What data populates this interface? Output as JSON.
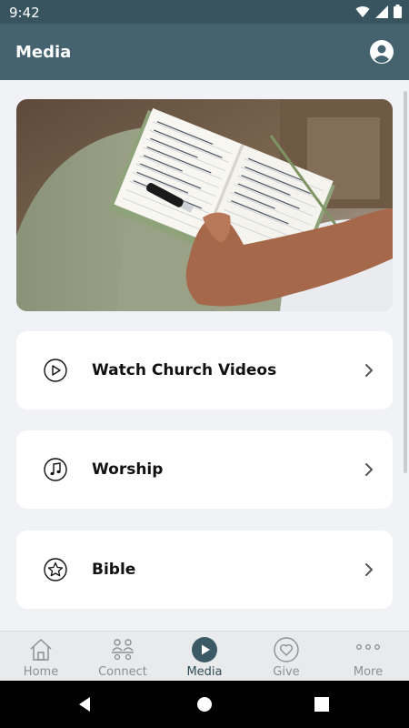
{
  "status_bar": {
    "time": "9:42"
  },
  "app_bar": {
    "title": "Media"
  },
  "cards": [
    {
      "label": "Watch Church Videos",
      "icon": "play-circle-icon"
    },
    {
      "label": "Worship",
      "icon": "music-note-icon"
    },
    {
      "label": "Bible",
      "icon": "star-icon"
    }
  ],
  "bottom_nav": {
    "items": [
      {
        "label": "Home",
        "icon": "home-icon"
      },
      {
        "label": "Connect",
        "icon": "people-icon"
      },
      {
        "label": "Media",
        "icon": "play-icon",
        "active": true
      },
      {
        "label": "Give",
        "icon": "heart-icon"
      },
      {
        "label": "More",
        "icon": "more-dots-icon"
      }
    ]
  },
  "colors": {
    "app_bar": "#45636f",
    "status_bar": "#37545f",
    "active_nav": "#3c5a66"
  }
}
